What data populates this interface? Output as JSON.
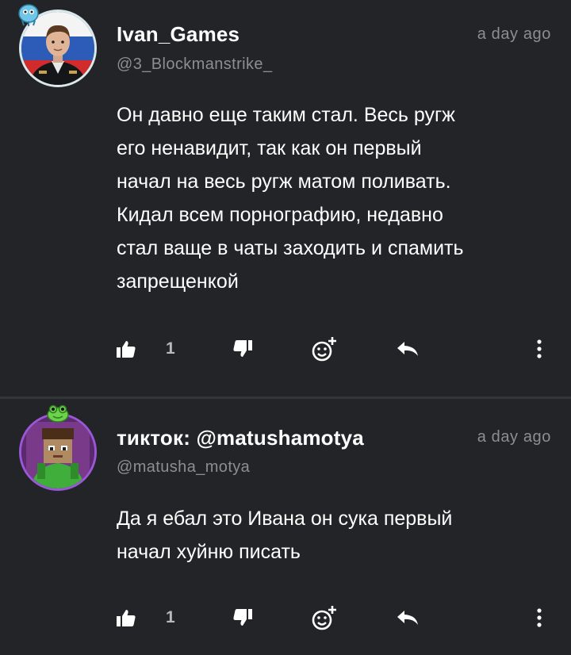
{
  "comments": [
    {
      "username": "Ivan_Games",
      "handle": "@3_Blockmanstrike_",
      "time": "a day ago",
      "text": "Он давно еще таким стал. Весь ругж\nего ненавидит, так как он первый\nначал на весь ругж матом поливать.\nКидал всем порнографию, недавно\nстал ваще в чаты заходить и спамить\nзапрещенкой",
      "like_count": "1"
    },
    {
      "username": "тикток: @matushamotya",
      "handle": "@matusha_motya",
      "time": "a day ago",
      "text": "Да я ебал это Ивана он сука первый\nначал хуйню писать",
      "like_count": "1"
    }
  ],
  "colors": {
    "background": "#222427",
    "divider": "#323539",
    "muted_text": "#8b8e92",
    "avatar_ring": "#d9e8ec"
  },
  "icons": [
    "badge-icon",
    "thumbs-up-icon",
    "thumbs-down-icon",
    "add-reaction-icon",
    "reply-icon",
    "more-vertical-icon"
  ]
}
